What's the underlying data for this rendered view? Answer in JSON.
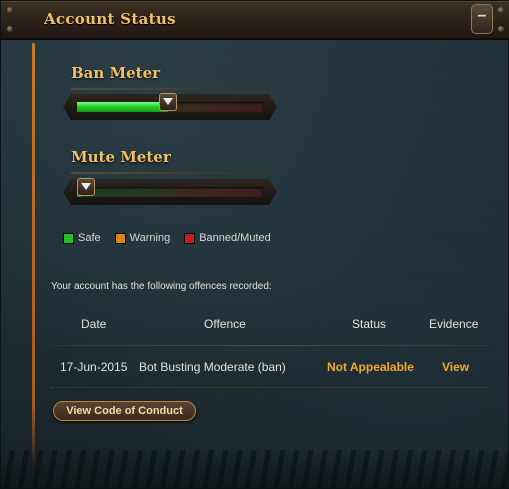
{
  "header": {
    "title": "Account Status",
    "collapse_label": "−"
  },
  "meters": {
    "ban": {
      "title": "Ban Meter",
      "level": 0.49
    },
    "mute": {
      "title": "Mute Meter",
      "level": 0.02
    }
  },
  "legend": [
    {
      "label": "Safe",
      "color": "#22c022"
    },
    {
      "label": "Warning",
      "color": "#d9861c"
    },
    {
      "label": "Banned/Muted",
      "color": "#c0201c"
    }
  ],
  "offences": {
    "intro": "Your account has the following offences recorded:",
    "columns": [
      "Date",
      "Offence",
      "Status",
      "Evidence"
    ],
    "rows": [
      {
        "date": "17-Jun-2015",
        "offence": "Bot Busting Moderate (ban)",
        "status": "Not Appealable",
        "evidence": "View"
      }
    ]
  },
  "actions": {
    "code_of_conduct": "View Code of Conduct"
  },
  "colors": {
    "accent_gold": "#f0c165",
    "status_orange": "#f0a830"
  }
}
